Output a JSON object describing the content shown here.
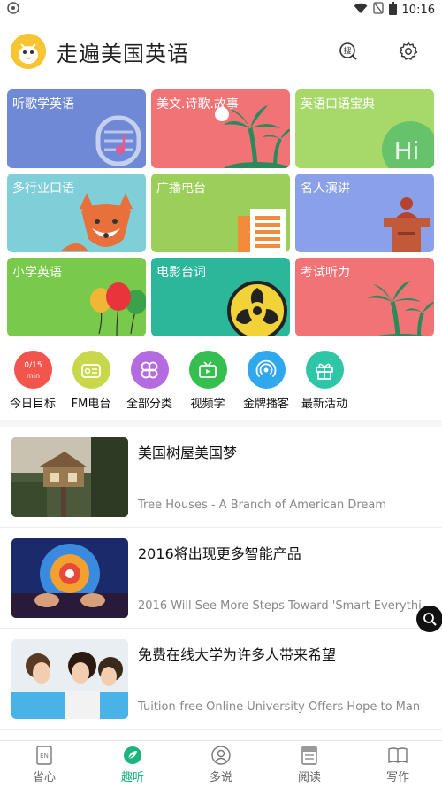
{
  "status": {
    "time": "10:16"
  },
  "header": {
    "title": "走遍美国英语",
    "search_icon_text": "搜"
  },
  "tiles": [
    {
      "label": "听歌学英语",
      "color": "#6f89d6"
    },
    {
      "label": "美文.诗歌.故事",
      "color": "#f27375"
    },
    {
      "label": "英语口语宝典",
      "color": "#a6d96a",
      "art_text": "Hi"
    },
    {
      "label": "多行业口语",
      "color": "#7fcfd9"
    },
    {
      "label": "广播电台",
      "color": "#9bcf5a"
    },
    {
      "label": "名人演讲",
      "color": "#8aa0e8"
    },
    {
      "label": "小学英语",
      "color": "#79c94a"
    },
    {
      "label": "电影台词",
      "color": "#2bb89a"
    },
    {
      "label": "考试听力",
      "color": "#f27375"
    }
  ],
  "quick": [
    {
      "label": "今日目标",
      "color": "#f2554c",
      "badge_top": "0/15",
      "badge_bottom": "min"
    },
    {
      "label": "FM电台",
      "color": "#c9d84a"
    },
    {
      "label": "全部分类",
      "color": "#b46be0"
    },
    {
      "label": "视频学",
      "color": "#35bf4f"
    },
    {
      "label": "金牌播客",
      "color": "#2fa8ee"
    },
    {
      "label": "最新活动",
      "color": "#2fc6a7"
    }
  ],
  "articles": [
    {
      "title": "美国树屋美国梦",
      "subtitle": "Tree Houses - A Branch of American Dream"
    },
    {
      "title": "2016将出现更多智能产品",
      "subtitle": "2016 Will See More Steps Toward 'Smart Everythi..."
    },
    {
      "title": "免费在线大学为许多人带来希望",
      "subtitle": "Tuition-free Online University Offers Hope to Many"
    }
  ],
  "nav": [
    {
      "label": "省心",
      "icon_text": "EN"
    },
    {
      "label": "趣听",
      "active": true
    },
    {
      "label": "多说"
    },
    {
      "label": "阅读"
    },
    {
      "label": "写作"
    }
  ],
  "colors": {
    "accent": "#1bb37e"
  }
}
